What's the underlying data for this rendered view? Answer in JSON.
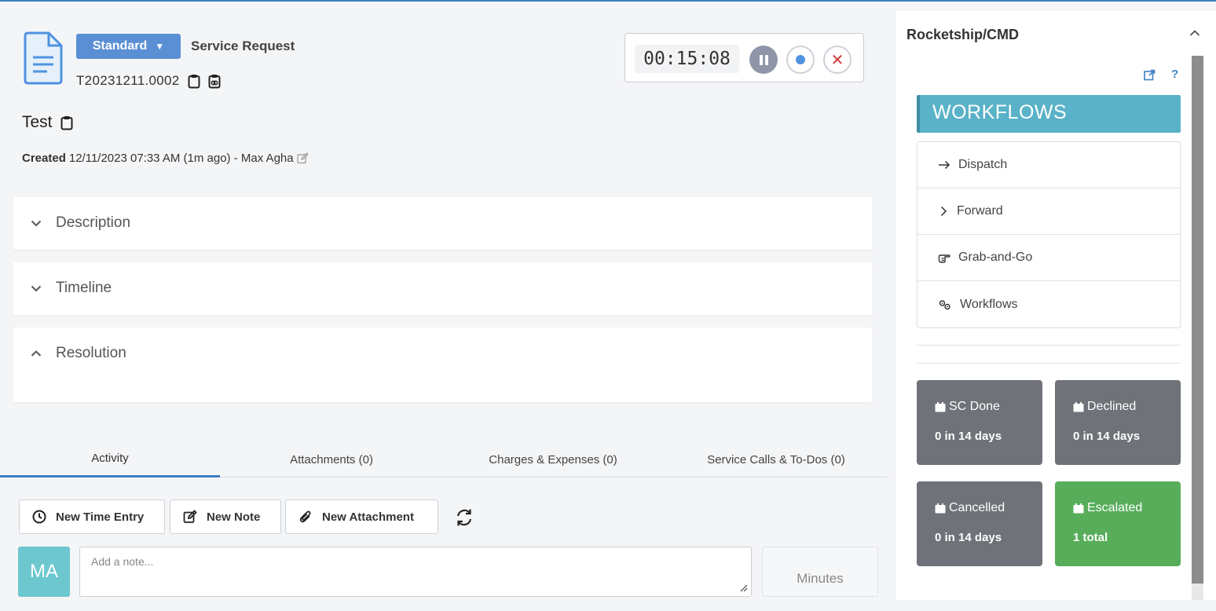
{
  "ticket": {
    "type_label": "Standard",
    "request_type": "Service Request",
    "number": "T20231211.0002",
    "title": "Test",
    "created_label": "Created",
    "created_info": "12/11/2023 07:33 AM (1m ago) - Max Agha"
  },
  "timer": {
    "value": "00:15:08"
  },
  "sections": [
    {
      "label": "Description",
      "state": "collapsed"
    },
    {
      "label": "Timeline",
      "state": "collapsed"
    },
    {
      "label": "Resolution",
      "state": "expanded"
    }
  ],
  "tabs": [
    {
      "label": "Activity",
      "active": true
    },
    {
      "label": "Attachments (0)"
    },
    {
      "label": "Charges & Expenses (0)"
    },
    {
      "label": "Service Calls & To-Dos (0)"
    }
  ],
  "actions": {
    "new_time_entry": "New Time Entry",
    "new_note": "New Note",
    "new_attachment": "New Attachment"
  },
  "note": {
    "avatar_initials": "MA",
    "placeholder": "Add a note...",
    "minutes_placeholder": "Minutes"
  },
  "right_panel": {
    "title": "Rocketship/CMD",
    "help": "?",
    "workflows_header": "WORKFLOWS",
    "workflow_items": [
      {
        "label": "Dispatch",
        "icon": "arrow-right-icon"
      },
      {
        "label": "Forward",
        "icon": "chevron-right-icon"
      },
      {
        "label": "Grab-and-Go",
        "icon": "hand-point-icon"
      },
      {
        "label": "Workflows",
        "icon": "gears-icon"
      }
    ],
    "tiles": [
      {
        "label": "SC Done",
        "value": "0 in 14 days",
        "color": "#6f7278"
      },
      {
        "label": "Declined",
        "value": "0 in 14 days",
        "color": "#6f7278"
      },
      {
        "label": "Cancelled",
        "value": "0 in 14 days",
        "color": "#6f7278"
      },
      {
        "label": "Escalated",
        "value": "1 total",
        "color": "#58ad5b"
      }
    ]
  },
  "colors": {
    "accent": "#3d7fc1",
    "badge": "#5b8fd4",
    "workflow": "#5ab2c8",
    "avatar": "#6cc7cf"
  }
}
